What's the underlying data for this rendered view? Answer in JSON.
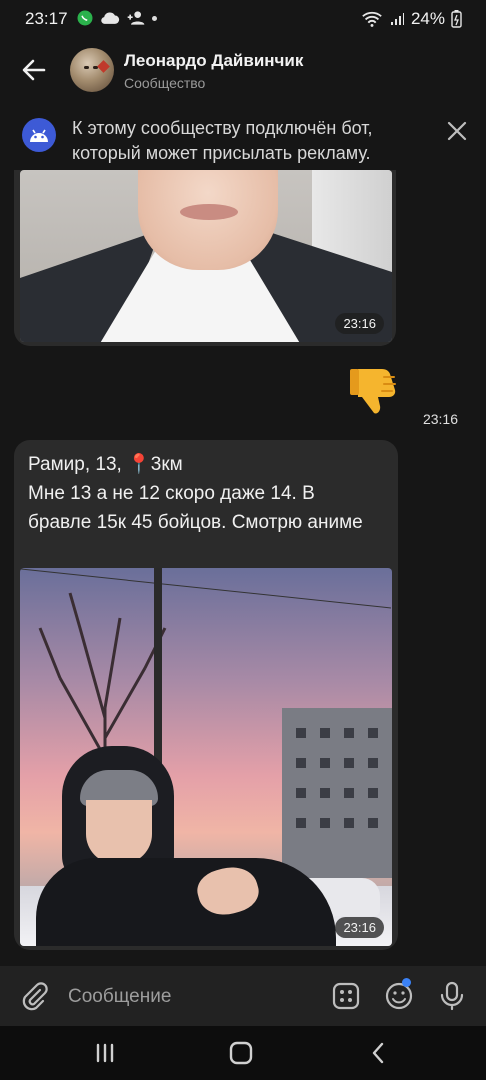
{
  "status_bar": {
    "time": "23:17",
    "battery": "24%",
    "icons_left": [
      "whatsapp-icon",
      "cloud-icon",
      "add-person-icon",
      "dot-icon"
    ],
    "icons_right": [
      "wifi-icon",
      "signal-icon",
      "battery-icon"
    ]
  },
  "header": {
    "title": "Леонардо Дайвинчик",
    "subtitle": "Сообщество"
  },
  "banner": {
    "text": "К этому сообществу подключён бот, который может присылать рекламу."
  },
  "messages": [
    {
      "type": "photo",
      "direction": "incoming",
      "time": "23:16"
    },
    {
      "type": "emoji",
      "direction": "outgoing",
      "emoji": "👎",
      "time": "23:16"
    },
    {
      "type": "text_photo",
      "direction": "incoming",
      "line1_prefix": "Рамир, 13,",
      "pin": "📍",
      "line1_suffix": "3км",
      "body": "Мне 13 а не 12 скоро даже 14. В бравле 15к 45 бойцов. Смотрю аниме",
      "time": "23:16"
    }
  ],
  "input": {
    "placeholder": "Сообщение"
  },
  "colors": {
    "background": "#161616",
    "bubble": "#2b2b2b",
    "accent": "#3d5ad6",
    "notification_dot": "#3b82f6"
  }
}
